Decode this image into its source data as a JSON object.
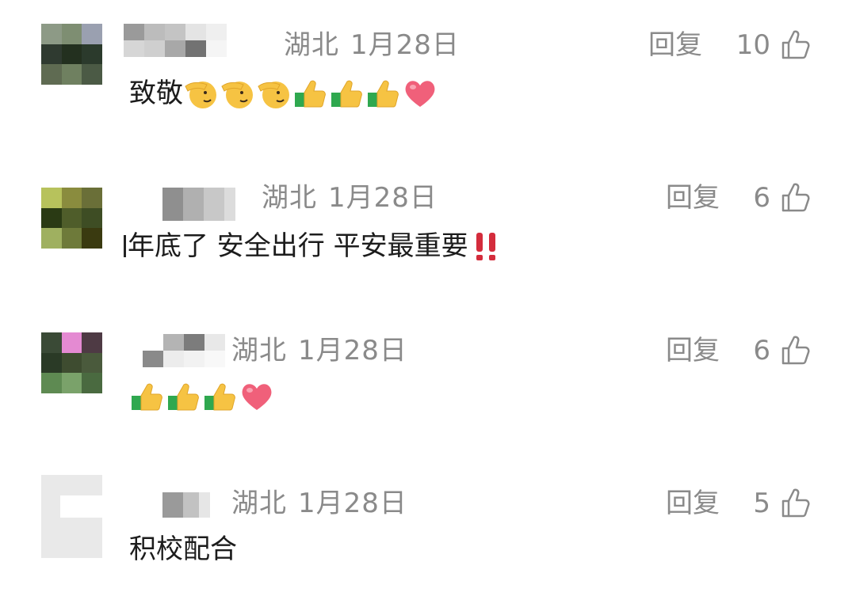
{
  "comments": [
    {
      "location": "湖北",
      "date": "1月28日",
      "reply_label": "回复",
      "likes": "10",
      "text": "致敬",
      "emojis": [
        "salute-emoji",
        "salute-emoji",
        "salute-emoji",
        "thumbs-up-emoji",
        "thumbs-up-emoji",
        "thumbs-up-emoji",
        "heart-emoji"
      ]
    },
    {
      "location": "湖北",
      "date": "1月28日",
      "reply_label": "回复",
      "likes": "6",
      "text": "年底了 安全出行 平安最重要",
      "emojis": [
        "double-exclamation-emoji"
      ]
    },
    {
      "location": "湖北",
      "date": "1月28日",
      "reply_label": "回复",
      "likes": "6",
      "text": "",
      "emojis": [
        "thumbs-up-emoji",
        "thumbs-up-emoji",
        "thumbs-up-emoji",
        "heart-emoji"
      ]
    },
    {
      "location": "湖北",
      "date": "1月28日",
      "reply_label": "回复",
      "likes": "5",
      "text": "积校配合",
      "emojis": []
    }
  ],
  "icons": {
    "like": "thumbs-up-outline-icon"
  },
  "colors": {
    "meta_text": "#8a8a8a",
    "body_text": "#1c1c1c",
    "heart": "#f0607a",
    "thumb": "#f6c343",
    "sleeve": "#2fa84f",
    "exclamation": "#d42c3c"
  }
}
